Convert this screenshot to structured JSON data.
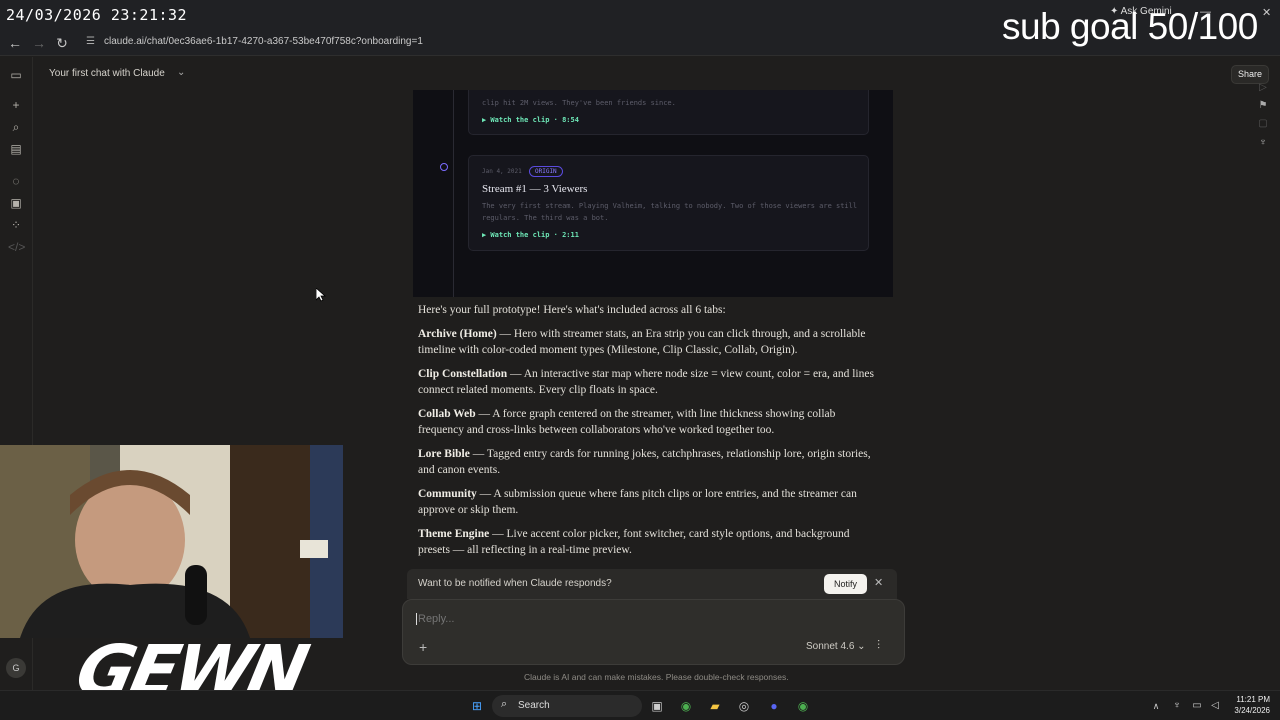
{
  "overlay": {
    "timestamp": "24/03/2026 23:21:32",
    "sub_goal": "sub goal 50/100"
  },
  "browser": {
    "url": "claude.ai/chat/0ec36ae6-1b17-4270-a367-53be470f758c?onboarding=1",
    "ask_gemini": "Ask Gemini"
  },
  "app": {
    "chat_title": "Your first chat with Claude",
    "share_label": "Share"
  },
  "preview": {
    "card1": {
      "desc": "clip hit 2M views. They've been friends since.",
      "link": "▶ Watch the clip · 8:54"
    },
    "card2": {
      "date": "Jan 4, 2021",
      "badge": "ORIGIN",
      "title": "Stream #1 — 3 Viewers",
      "desc": "The very first stream. Playing Valheim, talking to nobody. Two of those viewers are still regulars. The third was a bot.",
      "link": "▶ Watch the clip · 2:11"
    }
  },
  "message": {
    "intro": "Here's your full prototype! Here's what's included across all 6 tabs:",
    "tabs": [
      {
        "name": "Archive (Home)",
        "text": " — Hero with streamer stats, an Era strip you can click through, and a scrollable timeline with color-coded moment types (Milestone, Clip Classic, Collab, Origin)."
      },
      {
        "name": "Clip Constellation",
        "text": " — An interactive star map where node size = view count, color = era, and lines connect related moments. Every clip floats in space."
      },
      {
        "name": "Collab Web",
        "text": " — A force graph centered on the streamer, with line thickness showing collab frequency and cross-links between collaborators who've worked together too."
      },
      {
        "name": "Lore Bible",
        "text": " — Tagged entry cards for running jokes, catchphrases, relationship lore, origin stories, and canon events."
      },
      {
        "name": "Community",
        "text": " — A submission queue where fans pitch clips or lore entries, and the streamer can approve or skip them."
      },
      {
        "name": "Theme Engine",
        "text": " — Live accent color picker, font switcher, card style options, and background presets — all reflecting in a real-time preview."
      }
    ]
  },
  "notify": {
    "text": "Want to be notified when Claude responds?",
    "button": "Notify"
  },
  "reply": {
    "placeholder": "Reply...",
    "model": "Sonnet 4.6",
    "disclaimer": "Claude is AI and can make mistakes. Please double-check responses."
  },
  "stream": {
    "logo": "GEWN",
    "avatar_initial": "G"
  },
  "taskbar": {
    "search": "Search",
    "time": "11:21 PM",
    "date": "3/24/2026"
  },
  "colors": {
    "accent_green": "#6ee7b7",
    "accent_purple": "#7b6bff"
  }
}
